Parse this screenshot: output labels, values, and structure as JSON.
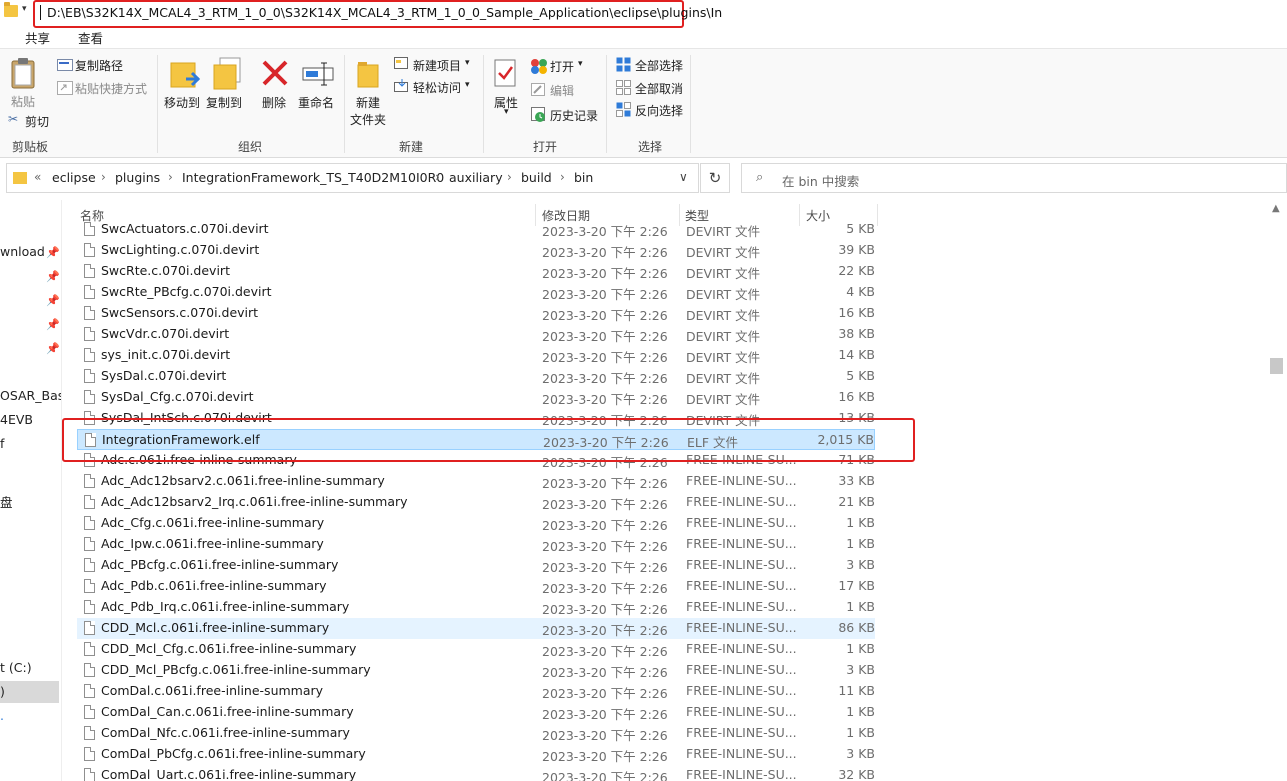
{
  "titlebar": {
    "path": "D:\\EB\\S32K14X_MCAL4_3_RTM_1_0_0\\S32K14X_MCAL4_3_RTM_1_0_0_Sample_Application\\eclipse\\plugins\\In",
    "dropdown_glyph": "▾"
  },
  "ribbon_tabs": [
    "共享",
    "查看"
  ],
  "ribbon": {
    "clipboard": {
      "paste": "粘贴",
      "copy_path": "复制路径",
      "paste_shortcut": "粘贴快捷方式",
      "cut": "剪切",
      "label": "剪贴板"
    },
    "organize": {
      "move_to": "移动到",
      "copy_to": "复制到",
      "delete": "删除",
      "rename": "重命名",
      "label": "组织"
    },
    "new": {
      "new_folder_line1": "新建",
      "new_folder_line2": "文件夹",
      "new_item": "新建项目",
      "easy_access": "轻松访问",
      "label": "新建"
    },
    "open": {
      "properties": "属性",
      "open": "打开",
      "edit": "编辑",
      "history": "历史记录",
      "label": "打开"
    },
    "select": {
      "select_all": "全部选择",
      "select_none": "全部取消",
      "invert": "反向选择",
      "label": "选择"
    }
  },
  "address": {
    "overflow": "«",
    "crumbs": [
      "eclipse",
      "plugins",
      "IntegrationFramework_TS_T40D2M10I0R0",
      "auxiliary",
      "build",
      "bin"
    ],
    "refresh_glyph": "↻",
    "dropdown_glyph": "∨"
  },
  "search": {
    "placeholder": "在 bin 中搜索",
    "icon": "search-icon"
  },
  "nav": [
    "wnload",
    "OSAR_Bas",
    "4EVB",
    "f",
    "盘",
    "t (C:)",
    ")",
    "."
  ],
  "columns": {
    "name": "名称",
    "date": "修改日期",
    "type": "类型",
    "size": "大小"
  },
  "files": [
    {
      "name": "SwcActuators.c.070i.devirt",
      "date": "2023-3-20 下午 2:26",
      "type": "DEVIRT 文件",
      "size": "5 KB"
    },
    {
      "name": "SwcLighting.c.070i.devirt",
      "date": "2023-3-20 下午 2:26",
      "type": "DEVIRT 文件",
      "size": "39 KB"
    },
    {
      "name": "SwcRte.c.070i.devirt",
      "date": "2023-3-20 下午 2:26",
      "type": "DEVIRT 文件",
      "size": "22 KB"
    },
    {
      "name": "SwcRte_PBcfg.c.070i.devirt",
      "date": "2023-3-20 下午 2:26",
      "type": "DEVIRT 文件",
      "size": "4 KB"
    },
    {
      "name": "SwcSensors.c.070i.devirt",
      "date": "2023-3-20 下午 2:26",
      "type": "DEVIRT 文件",
      "size": "16 KB"
    },
    {
      "name": "SwcVdr.c.070i.devirt",
      "date": "2023-3-20 下午 2:26",
      "type": "DEVIRT 文件",
      "size": "38 KB"
    },
    {
      "name": "sys_init.c.070i.devirt",
      "date": "2023-3-20 下午 2:26",
      "type": "DEVIRT 文件",
      "size": "14 KB"
    },
    {
      "name": "SysDal.c.070i.devirt",
      "date": "2023-3-20 下午 2:26",
      "type": "DEVIRT 文件",
      "size": "5 KB"
    },
    {
      "name": "SysDal_Cfg.c.070i.devirt",
      "date": "2023-3-20 下午 2:26",
      "type": "DEVIRT 文件",
      "size": "16 KB"
    },
    {
      "name": "SysDal_IntSch.c.070i.devirt",
      "date": "2023-3-20 下午 2:26",
      "type": "DEVIRT 文件",
      "size": "13 KB"
    },
    {
      "name": "IntegrationFramework.elf",
      "date": "2023-3-20 下午 2:26",
      "type": "ELF 文件",
      "size": "2,015 KB"
    },
    {
      "name": "Adc.c.061i.free-inline-summary",
      "date": "2023-3-20 下午 2:26",
      "type": "FREE-INLINE-SU...",
      "size": "71 KB"
    },
    {
      "name": "Adc_Adc12bsarv2.c.061i.free-inline-summary",
      "date": "2023-3-20 下午 2:26",
      "type": "FREE-INLINE-SU...",
      "size": "33 KB"
    },
    {
      "name": "Adc_Adc12bsarv2_Irq.c.061i.free-inline-summary",
      "date": "2023-3-20 下午 2:26",
      "type": "FREE-INLINE-SU...",
      "size": "21 KB"
    },
    {
      "name": "Adc_Cfg.c.061i.free-inline-summary",
      "date": "2023-3-20 下午 2:26",
      "type": "FREE-INLINE-SU...",
      "size": "1 KB"
    },
    {
      "name": "Adc_Ipw.c.061i.free-inline-summary",
      "date": "2023-3-20 下午 2:26",
      "type": "FREE-INLINE-SU...",
      "size": "1 KB"
    },
    {
      "name": "Adc_PBcfg.c.061i.free-inline-summary",
      "date": "2023-3-20 下午 2:26",
      "type": "FREE-INLINE-SU...",
      "size": "3 KB"
    },
    {
      "name": "Adc_Pdb.c.061i.free-inline-summary",
      "date": "2023-3-20 下午 2:26",
      "type": "FREE-INLINE-SU...",
      "size": "17 KB"
    },
    {
      "name": "Adc_Pdb_Irq.c.061i.free-inline-summary",
      "date": "2023-3-20 下午 2:26",
      "type": "FREE-INLINE-SU...",
      "size": "1 KB"
    },
    {
      "name": "CDD_Mcl.c.061i.free-inline-summary",
      "date": "2023-3-20 下午 2:26",
      "type": "FREE-INLINE-SU...",
      "size": "86 KB"
    },
    {
      "name": "CDD_Mcl_Cfg.c.061i.free-inline-summary",
      "date": "2023-3-20 下午 2:26",
      "type": "FREE-INLINE-SU...",
      "size": "1 KB"
    },
    {
      "name": "CDD_Mcl_PBcfg.c.061i.free-inline-summary",
      "date": "2023-3-20 下午 2:26",
      "type": "FREE-INLINE-SU...",
      "size": "3 KB"
    },
    {
      "name": "ComDal.c.061i.free-inline-summary",
      "date": "2023-3-20 下午 2:26",
      "type": "FREE-INLINE-SU...",
      "size": "11 KB"
    },
    {
      "name": "ComDal_Can.c.061i.free-inline-summary",
      "date": "2023-3-20 下午 2:26",
      "type": "FREE-INLINE-SU...",
      "size": "1 KB"
    },
    {
      "name": "ComDal_Nfc.c.061i.free-inline-summary",
      "date": "2023-3-20 下午 2:26",
      "type": "FREE-INLINE-SU...",
      "size": "1 KB"
    },
    {
      "name": "ComDal_PbCfg.c.061i.free-inline-summary",
      "date": "2023-3-20 下午 2:26",
      "type": "FREE-INLINE-SU...",
      "size": "3 KB"
    },
    {
      "name": "ComDal_Uart.c.061i.free-inline-summary",
      "date": "2023-3-20 下午 2:26",
      "type": "FREE-INLINE-SU...",
      "size": "32 KB"
    }
  ],
  "colors": {
    "highlight_red": "#e02020",
    "selection": "#cce8ff",
    "hover": "#e5f3ff"
  }
}
